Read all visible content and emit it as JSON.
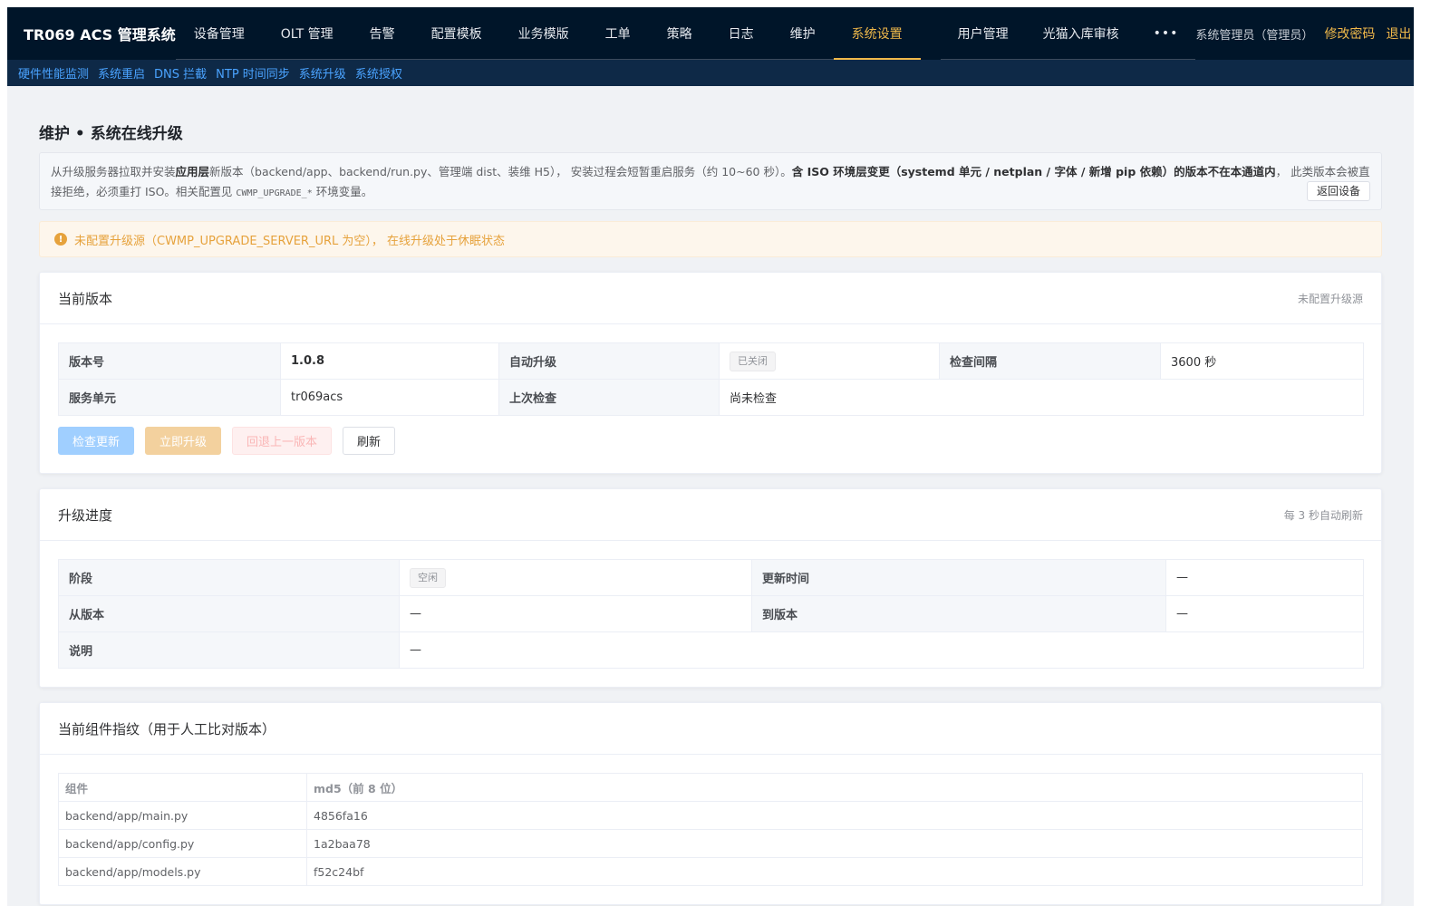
{
  "app": {
    "brand": "TR069 ACS 管理系统"
  },
  "nav": {
    "items": [
      {
        "label": "设备管理"
      },
      {
        "label": "OLT 管理"
      },
      {
        "label": "告警"
      },
      {
        "label": "配置模板"
      },
      {
        "label": "业务模版"
      },
      {
        "label": "工单"
      },
      {
        "label": "策略"
      },
      {
        "label": "日志"
      },
      {
        "label": "维护"
      },
      {
        "label": "系统设置"
      }
    ],
    "items2": [
      {
        "label": "用户管理"
      },
      {
        "label": "光猫入库审核"
      }
    ],
    "more": "•••",
    "user": "系统管理员（管理员）",
    "change_password": "修改密码",
    "logout": "退出"
  },
  "subnav": {
    "items": [
      {
        "label": "硬件性能监测"
      },
      {
        "label": "系统重启"
      },
      {
        "label": "DNS 拦截"
      },
      {
        "label": "NTP 时间同步"
      },
      {
        "label": "系统升级"
      },
      {
        "label": "系统授权"
      }
    ]
  },
  "page": {
    "title": "维护 • 系统在线升级",
    "desc": {
      "p1": "从升级服务器拉取并安装",
      "b1": "应用层",
      "p2": "新版本（backend/app、backend/run.py、管理端 dist、装维 H5）， 安装过程会短暂重启服务（约 10~60 秒）。",
      "b2": "含 ISO 环境层变更（systemd 单元 / netplan / 字体 / 新增 pip 依赖）的版本不在本通道内",
      "p3": "， 此类版本会被直接拒绝，必须重打 ISO。相关配置见 ",
      "code": "CWMP_UPGRADE_*",
      "p4": " 环境变量。"
    },
    "back_button": "返回设备",
    "alert": "未配置升级源（CWMP_UPGRADE_SERVER_URL 为空）， 在线升级处于休眠状态"
  },
  "current_version": {
    "title": "当前版本",
    "extra": "未配置升级源",
    "version_label": "版本号",
    "version_value": "1.0.8",
    "auto_label": "自动升级",
    "auto_value": "已关闭",
    "interval_label": "检查间隔",
    "interval_value": "3600 秒",
    "service_label": "服务单元",
    "service_value": "tr069acs",
    "last_check_label": "上次检查",
    "last_check_value": "尚未检查",
    "buttons": {
      "check": "检查更新",
      "upgrade": "立即升级",
      "rollback": "回退上一版本",
      "refresh": "刷新"
    }
  },
  "progress": {
    "title": "升级进度",
    "extra": "每 3 秒自动刷新",
    "stage_label": "阶段",
    "stage_value": "空闲",
    "updated_label": "更新时间",
    "updated_value": "—",
    "from_label": "从版本",
    "from_value": "—",
    "to_label": "到版本",
    "to_value": "—",
    "note_label": "说明",
    "note_value": "—"
  },
  "fingerprint": {
    "title": "当前组件指纹（用于人工比对版本）",
    "col_component": "组件",
    "col_md5": "md5（前 8 位）",
    "rows": [
      {
        "component": "backend/app/main.py",
        "md5": "4856fa16"
      },
      {
        "component": "backend/app/config.py",
        "md5": "1a2baa78"
      },
      {
        "component": "backend/app/models.py",
        "md5": "f52c24bf"
      }
    ]
  },
  "colors": {
    "nav_bg": "#001529",
    "active": "#f0b94a",
    "link": "#4aa3ff",
    "warning": "#e6a23c"
  }
}
